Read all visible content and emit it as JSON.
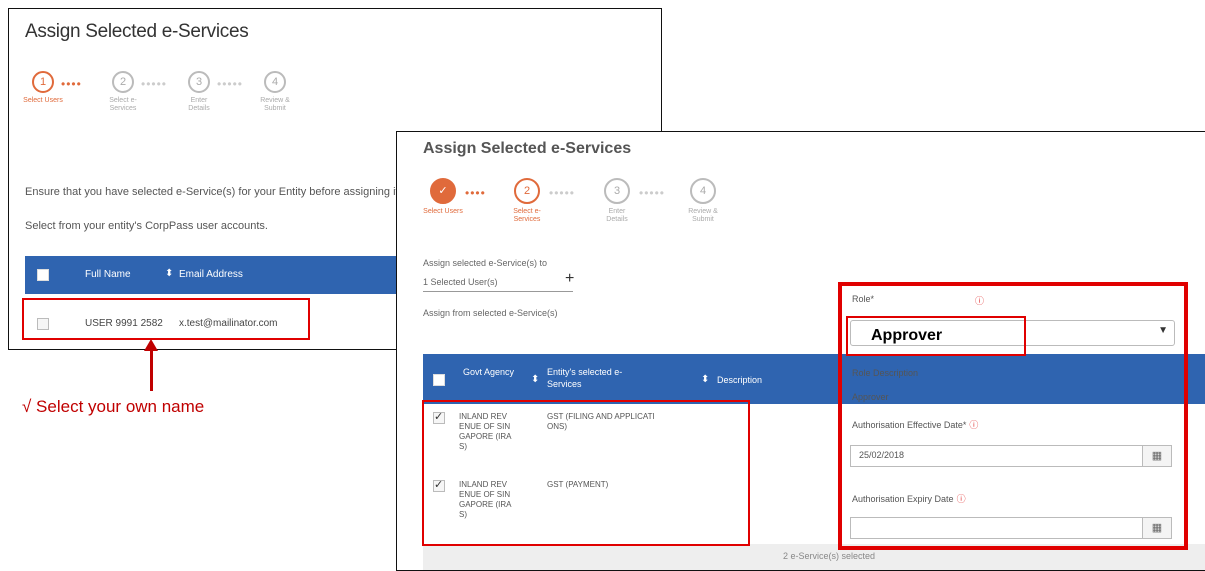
{
  "back": {
    "title": "Assign Selected e-Services",
    "steps": [
      {
        "num": "1",
        "caption": "Select Users"
      },
      {
        "num": "2",
        "caption": "Select e-Services"
      },
      {
        "num": "3",
        "caption": "Enter Details"
      },
      {
        "num": "4",
        "caption": "Review & Submit"
      }
    ],
    "desc1": "Ensure that you have selected e-Service(s) for your Entity before assigning it to you",
    "desc2": "Select from your entity's CorpPass user accounts.",
    "table": {
      "headers": [
        "Full Name",
        "Email Address"
      ],
      "row": {
        "name": "USER 9991 2582",
        "email": "x.test@mailinator.com"
      }
    }
  },
  "front": {
    "title": "Assign Selected e-Services",
    "steps": [
      {
        "num": "✓",
        "caption": "Select Users"
      },
      {
        "num": "2",
        "caption": "Select e-Services"
      },
      {
        "num": "3",
        "caption": "Enter Details"
      },
      {
        "num": "4",
        "caption": "Review & Submit"
      }
    ],
    "assign_to_label": "Assign selected e-Service(s) to",
    "selected_users": "1 Selected User(s)",
    "assign_from_label": "Assign from selected e-Service(s)",
    "table": {
      "headers": [
        "Govt Agency",
        "Entity's selected e-Services",
        "Description"
      ],
      "rows": [
        {
          "agency": "INLAND REV ENUE OF SIN GAPORE (IRA S)",
          "service": "GST (FILING AND APPLICATI ONS)"
        },
        {
          "agency": "INLAND REV ENUE OF SIN GAPORE (IRA S)",
          "service": "GST (PAYMENT)"
        }
      ],
      "footer": "2 e-Service(s) selected"
    },
    "form": {
      "role_label": "Role*",
      "role_value": "Approver",
      "role_desc_label": "Role Description",
      "role_desc_value": "Approver",
      "effective_label": "Authorisation Effective Date*",
      "effective_value": "25/02/2018",
      "expiry_label": "Authorisation Expiry Date",
      "expiry_value": ""
    }
  },
  "annotation": {
    "text": "√ Select your own name"
  },
  "colors": {
    "header_blue": "#2f64b0",
    "accent_orange": "#e06a3b",
    "annotation_red": "#e00000"
  }
}
